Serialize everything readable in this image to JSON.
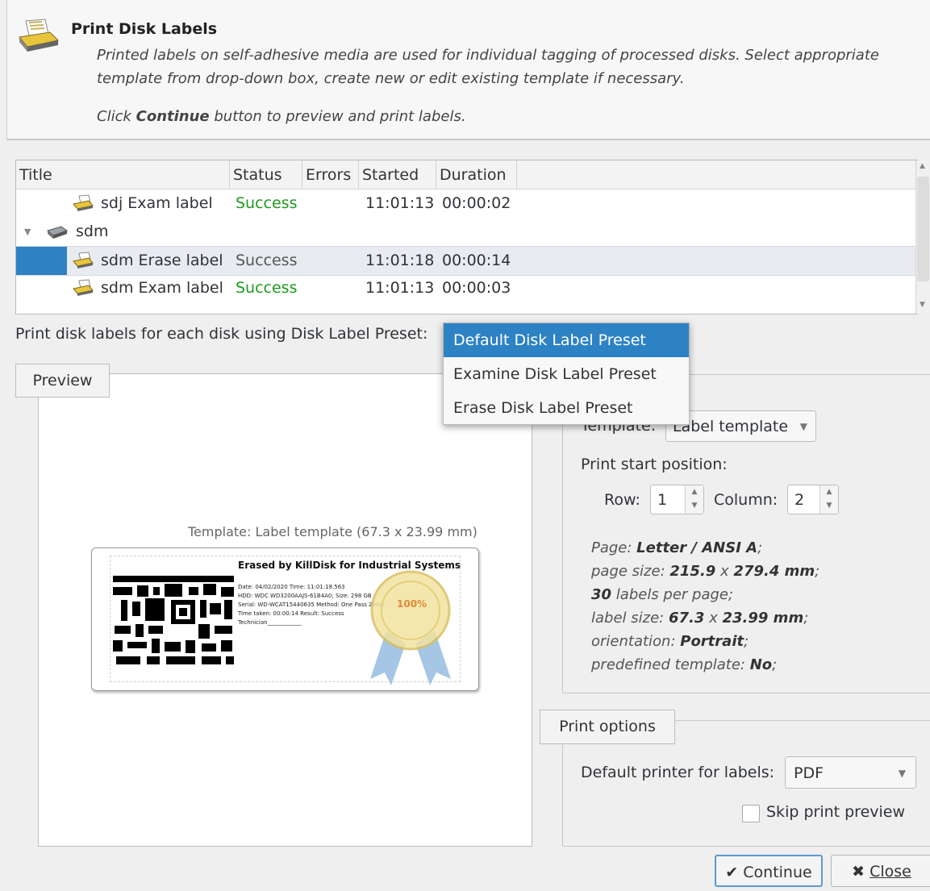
{
  "header": {
    "title": "Print Disk Labels",
    "desc_line1": "Printed labels on self-adhesive media are used for individual tagging of processed disks. Select appropriate",
    "desc_line2": "template from drop-down box, create new or edit existing template if necessary.",
    "hint_pre": "Click ",
    "hint_bold": "Continue",
    "hint_post": " button to preview and print labels."
  },
  "table": {
    "columns": [
      "Title",
      "Status",
      "Errors",
      "Started",
      "Duration"
    ],
    "rows": [
      {
        "title": "sdj Exam label",
        "status": "Success",
        "errors": "",
        "started": "11:01:13",
        "duration": "00:00:02"
      },
      {
        "title": "sdm",
        "status": "",
        "errors": "",
        "started": "",
        "duration": ""
      },
      {
        "title": "sdm Erase label",
        "status": "Success",
        "errors": "",
        "started": "11:01:18",
        "duration": "00:00:14"
      },
      {
        "title": "sdm Exam label",
        "status": "Success",
        "errors": "",
        "started": "11:01:13",
        "duration": "00:00:03"
      }
    ]
  },
  "preset": {
    "label": "Print disk labels for each disk using Disk Label Preset:",
    "options": [
      "Default Disk Label Preset",
      "Examine Disk Label Preset",
      "Erase Disk Label Preset"
    ],
    "selected": "Default Disk Label Preset"
  },
  "preview": {
    "tab": "Preview",
    "caption": "Template: Label template (67.3 x 23.99 mm)",
    "label": {
      "heading": "Erased by KillDisk for Industrial Systems",
      "line1": "Date: 04/02/2020 Time: 11:01:18.563",
      "line2": "HDD: WDC WD3200AAJS-61B4A0; Size: 298 GB",
      "line3": "Serial: WD-WCAT15440635 Method: One Pass Zeros",
      "line4": "Time taken: 00:00:14 Result: Success",
      "line5": "Technician____________",
      "seal": "100%"
    }
  },
  "settings": {
    "template_label": "Template:",
    "template_value": "Label template",
    "start_position": "Print start position:",
    "row_label": "Row:",
    "row_value": "1",
    "column_label": "Column:",
    "column_value": "2",
    "info": {
      "page_pre": "Page: ",
      "page": "Letter / ANSI A",
      "page_post": ";",
      "size_pre": "page size: ",
      "size_w": "215.9",
      "size_x": " x ",
      "size_h": "279.4 mm",
      "size_post": ";",
      "labels_count": "30",
      "labels_post": " labels per page;",
      "lsize_pre": "label size: ",
      "lsize_w": "67.3",
      "lsize_x": " x ",
      "lsize_h": "23.99 mm",
      "lsize_post": ";",
      "orient_pre": "orientation: ",
      "orient": "Portrait",
      "orient_post": ";",
      "predef_pre": "predefined template: ",
      "predef": "No",
      "predef_post": ";"
    }
  },
  "print_options": {
    "tab": "Print options",
    "printer_label": "Default printer for labels:",
    "printer_value": "PDF",
    "skip_preview_label": "Skip print preview",
    "skip_preview_checked": false
  },
  "buttons": {
    "continue": "Continue",
    "close": "Close"
  },
  "colors": {
    "accent": "#2d82c4",
    "success": "#1e9a1e"
  }
}
